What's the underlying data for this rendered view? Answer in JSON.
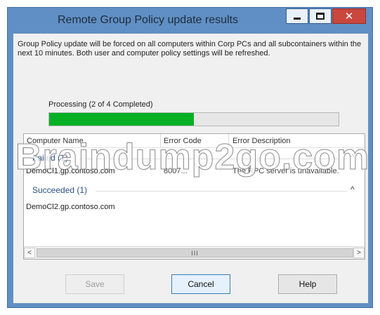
{
  "window": {
    "title": "Remote Group Policy update results"
  },
  "info_text": "Group Policy update will be forced on all computers within Corp PCs and all subcontainers within the next 10 minutes. Both user and computer policy settings will be refreshed.",
  "progress": {
    "label": "Processing (2 of 4 Completed)",
    "completed": 2,
    "total": 4,
    "fraction": 0.5,
    "color": "#06b025"
  },
  "table": {
    "columns": [
      "Computer Name",
      "Error Code",
      "Error Description"
    ],
    "groups": [
      {
        "header": "Failed (1)",
        "rows": [
          {
            "computer": "DemoCl1.gp.contoso.com",
            "code": "8007...",
            "description": "The RPC server is unavailable."
          }
        ]
      },
      {
        "header": "Succeeded (1)",
        "rows": [
          {
            "computer": "DemoCl2.gp.contoso.com",
            "code": "",
            "description": ""
          }
        ]
      }
    ],
    "scroll_thumb_grip": "III"
  },
  "buttons": {
    "save": "Save",
    "cancel": "Cancel",
    "help": "Help"
  },
  "watermark": "Braindump2go.com",
  "colors": {
    "frame": "#5f8fc4",
    "close_button": "#c9473d",
    "group_header": "#2a4f86"
  }
}
